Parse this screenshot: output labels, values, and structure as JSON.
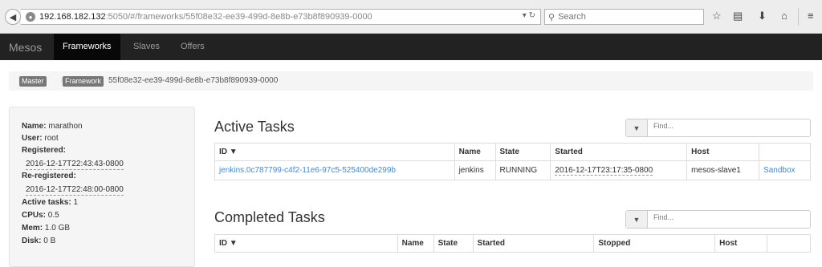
{
  "browser": {
    "url_host": "192.168.182.132",
    "url_rest": ":5050/#/frameworks/55f08e32-ee39-499d-8e8b-e73b8f890939-0000",
    "search_placeholder": "Search"
  },
  "nav": {
    "brand": "Mesos",
    "items": [
      {
        "label": "Frameworks"
      },
      {
        "label": "Slaves"
      },
      {
        "label": "Offers"
      }
    ]
  },
  "breadcrumb": {
    "master": "Master",
    "framework": "Framework",
    "framework_id": "55f08e32-ee39-499d-8e8b-e73b8f890939-0000"
  },
  "info": {
    "name_label": "Name:",
    "name": "marathon",
    "user_label": "User:",
    "user": "root",
    "registered_label": "Registered:",
    "registered": "2016-12-17T22:43:43-0800",
    "reregistered_label": "Re-registered:",
    "reregistered": "2016-12-17T22:48:00-0800",
    "active_tasks_label": "Active tasks:",
    "active_tasks": "1",
    "cpus_label": "CPUs:",
    "cpus": "0.5",
    "mem_label": "Mem:",
    "mem": "1.0 GB",
    "disk_label": "Disk:",
    "disk": "0 B"
  },
  "active": {
    "title": "Active Tasks",
    "filter_placeholder": "Find...",
    "headers": {
      "id": "ID ▼",
      "name": "Name",
      "state": "State",
      "started": "Started",
      "host": "Host"
    },
    "rows": [
      {
        "id": "jenkins.0c787799-c4f2-11e6-97c5-525400de299b",
        "name": "jenkins",
        "state": "RUNNING",
        "started": "2016-12-17T23:17:35-0800",
        "host": "mesos-slave1",
        "link": "Sandbox"
      }
    ]
  },
  "completed": {
    "title": "Completed Tasks",
    "filter_placeholder": "Find...",
    "headers": {
      "id": "ID ▼",
      "name": "Name",
      "state": "State",
      "started": "Started",
      "stopped": "Stopped",
      "host": "Host"
    }
  }
}
